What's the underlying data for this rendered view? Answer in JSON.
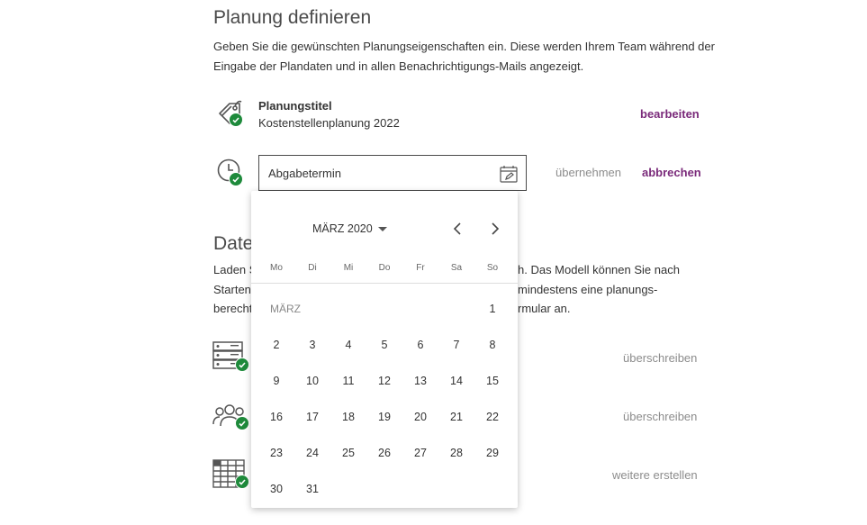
{
  "header": {
    "title": "Planung definieren",
    "description": "Geben Sie die gewünschten Planungseigenschaften ein. Diese werden Ihrem Team während der Eingabe der Plandaten und in allen Benachrichtigungs-Mails angezeigt."
  },
  "title_row": {
    "label": "Planungstitel",
    "value": "Kostenstellenplanung 2022",
    "action": "bearbeiten",
    "icon": "tag-icon"
  },
  "deadline_row": {
    "placeholder": "Abgabetermin",
    "apply": "übernehmen",
    "cancel": "abbrechen",
    "icon": "clock-icon"
  },
  "data_section": {
    "title_visible": "Date",
    "line1_left": "Laden S",
    "line1_right": "h. Das Modell können Sie nach",
    "line2_left": "Starten",
    "line2_right": "mindestens eine planungs-",
    "line3_left": "berecht",
    "line3_right": "rmular an.",
    "rows": [
      {
        "action": "überschreiben",
        "icon": "database-icon"
      },
      {
        "action": "überschreiben",
        "icon": "users-icon"
      },
      {
        "action": "weitere erstellen",
        "icon": "table-icon"
      }
    ]
  },
  "calendar": {
    "month_year": "MÄRZ 2020",
    "month_label": "MÄRZ",
    "weekdays": [
      "Mo",
      "Di",
      "Mi",
      "Do",
      "Fr",
      "Sa",
      "So"
    ],
    "first_weekday_index": 6,
    "days": [
      "1",
      "2",
      "3",
      "4",
      "5",
      "6",
      "7",
      "8",
      "9",
      "10",
      "11",
      "12",
      "13",
      "14",
      "15",
      "16",
      "17",
      "18",
      "19",
      "20",
      "21",
      "22",
      "23",
      "24",
      "25",
      "26",
      "27",
      "28",
      "29",
      "30",
      "31"
    ]
  },
  "colors": {
    "accent": "#7a2a7a",
    "check": "#1e8a3b"
  }
}
